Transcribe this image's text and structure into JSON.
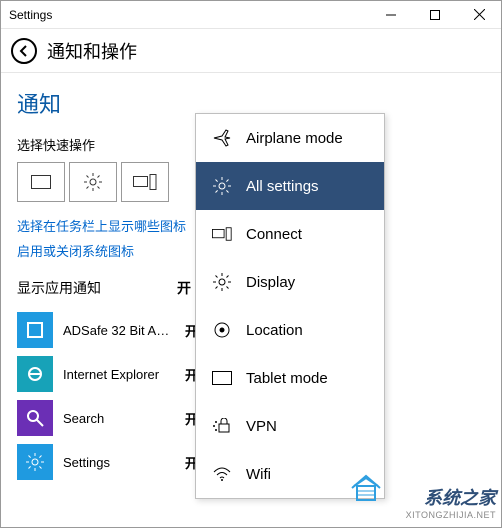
{
  "window": {
    "title": "Settings"
  },
  "header": {
    "title": "通知和操作"
  },
  "notifications": {
    "section_title": "通知",
    "quick_actions_label": "选择快速操作",
    "link_taskbar_icons": "选择在任务栏上显示哪些图标",
    "link_system_icons": "启用或关闭系统图标",
    "apps_header_label": "显示应用通知",
    "apps_header_state": "开"
  },
  "apps": [
    {
      "name": "ADSafe 32 Bit App…",
      "state": "开",
      "color": "#1f9ae0",
      "icon": "adsafe"
    },
    {
      "name": "Internet Explorer",
      "state": "开",
      "color": "#17a2b8",
      "icon": "ie"
    },
    {
      "name": "Search",
      "state": "开",
      "color": "#6b2fb5",
      "icon": "search"
    },
    {
      "name": "Settings",
      "state": "开",
      "color": "#1f9ae0",
      "icon": "gear"
    }
  ],
  "popup": {
    "items": [
      {
        "label": "Airplane mode",
        "icon": "airplane",
        "selected": false
      },
      {
        "label": "All settings",
        "icon": "gear",
        "selected": true
      },
      {
        "label": "Connect",
        "icon": "connect",
        "selected": false
      },
      {
        "label": "Display",
        "icon": "brightness",
        "selected": false
      },
      {
        "label": "Location",
        "icon": "location",
        "selected": false
      },
      {
        "label": "Tablet mode",
        "icon": "tablet",
        "selected": false
      },
      {
        "label": "VPN",
        "icon": "vpn",
        "selected": false
      },
      {
        "label": "Wifi",
        "icon": "wifi",
        "selected": false
      }
    ]
  },
  "watermark": {
    "cn": "系统之家",
    "url": "XITONGZHIJIA.NET"
  }
}
